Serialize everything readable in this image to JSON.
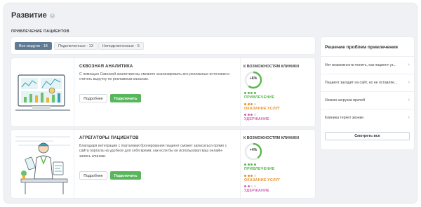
{
  "page": {
    "title": "Развитие",
    "section_subtitle": "ПРИВЛЕЧЕНИЕ ПАЦИЕНТОВ"
  },
  "filters": [
    {
      "label": "Все модули · 18",
      "active": true
    },
    {
      "label": "Подключенные · 13",
      "active": false
    },
    {
      "label": "Неподключенные · 5",
      "active": false
    }
  ],
  "modules": [
    {
      "title": "СКВОЗНАЯ АНАЛИТИКА",
      "description": "С помощью Сквозной аналитики вы сможете анализировать все рекламные источники и считать выручку по рекламным каналам.",
      "more_label": "Подробнее",
      "connect_label": "Подключить",
      "opportunities_title": "К ВОЗМОЖНОСТЯМ КЛИНИКИ",
      "gauge_value": "+6%",
      "gauge_fraction": 0.6,
      "metrics": [
        {
          "label": "ПРИВЛЕЧЕНИЕ",
          "color": "#59b84f",
          "dots_filled": 4
        },
        {
          "label": "ОКАЗАНИЕ УСЛУГ",
          "color": "#e8922d",
          "dots_filled": 3
        },
        {
          "label": "УДЕРЖАНИЕ",
          "color": "#d464b4",
          "dots_filled": 3
        }
      ]
    },
    {
      "title": "АГРЕГАТОРЫ ПАЦИЕНТОВ",
      "description": "Благодаря интеграции с порталами бронирования пациент сможет записаться прямо с сайта портала на удобное для себя время, как если бы он использовал ваш онлайн-запись клиники.",
      "more_label": "Подробнее",
      "connect_label": "Подключить",
      "opportunities_title": "К ВОЗМОЖНОСТЯМ КЛИНИКИ",
      "gauge_value": "+4%",
      "gauge_fraction": 0.4,
      "metrics": [
        {
          "label": "ПРИВЛЕЧЕНИЕ",
          "color": "#59b84f",
          "dots_filled": 4
        },
        {
          "label": "ОКАЗАНИЕ УСЛУГ",
          "color": "#e8922d",
          "dots_filled": 3
        },
        {
          "label": "УДЕРЖАНИЕ",
          "color": "#d464b4",
          "dots_filled": 2
        }
      ]
    }
  ],
  "side_panel": {
    "title": "Решение проблем привлечения",
    "items": [
      {
        "label": "Нет возможности понять, как пациент уз..."
      },
      {
        "label": "Пациент заходит на сайт, но не оставляе..."
      },
      {
        "label": "Низкая загрузка врачей"
      },
      {
        "label": "Клиника теряет звонки"
      }
    ],
    "see_all_label": "Смотреть все"
  },
  "colors": {
    "accent_green": "#58b65c",
    "active_tab": "#5f7a94",
    "gauge_track": "#e6e9ec",
    "dot_empty": "#dde1e5"
  },
  "icons": {
    "info": "info-icon",
    "chevron": "chevron-right-icon"
  }
}
